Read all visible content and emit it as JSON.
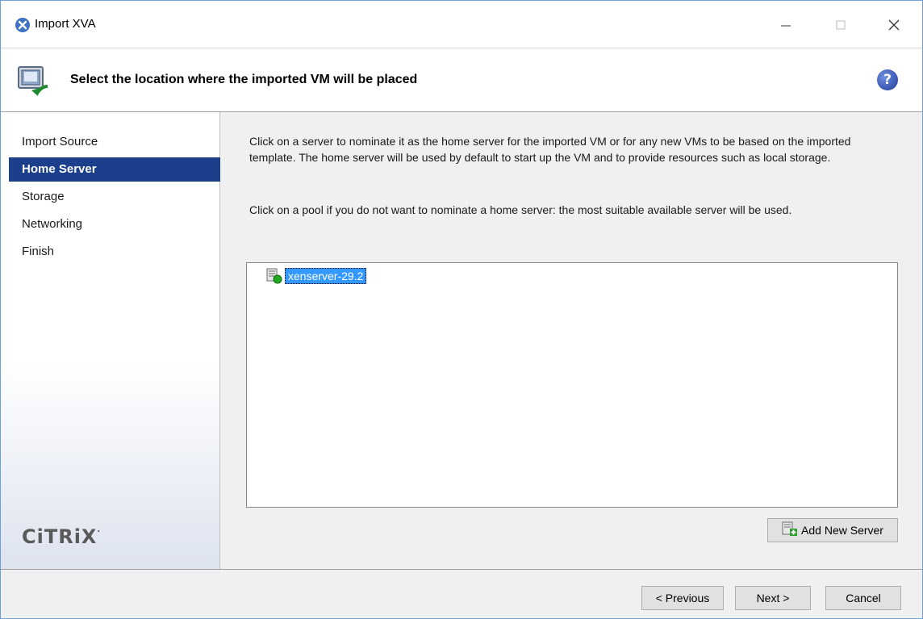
{
  "window": {
    "title": "Import XVA",
    "icon": "xenserver-x-icon"
  },
  "header": {
    "title": "Select the location where the imported VM will be placed",
    "help_icon": "?"
  },
  "sidebar": {
    "items": [
      {
        "label": "Import Source",
        "active": false
      },
      {
        "label": "Home Server",
        "active": true
      },
      {
        "label": "Storage",
        "active": false
      },
      {
        "label": "Networking",
        "active": false
      },
      {
        "label": "Finish",
        "active": false
      }
    ],
    "logo": "CiTRiX"
  },
  "main": {
    "paragraph1": "Click on a server to nominate it as the home server for the imported VM or for any new VMs to be based on the imported template. The home server will be used by default to start up the VM and to provide resources such as local storage.",
    "paragraph2": "Click on a pool if you do not want to nominate a home server: the most suitable available server will be used.",
    "servers": [
      {
        "name": "xenserver-29.2",
        "selected": true
      }
    ],
    "add_server_label": "Add New Server"
  },
  "footer": {
    "previous_label": "< Previous",
    "next_label": "Next >",
    "cancel_label": "Cancel"
  },
  "colors": {
    "nav_active": "#1c3f8c",
    "selection": "#3399ff",
    "server_status": "#22aa22"
  }
}
